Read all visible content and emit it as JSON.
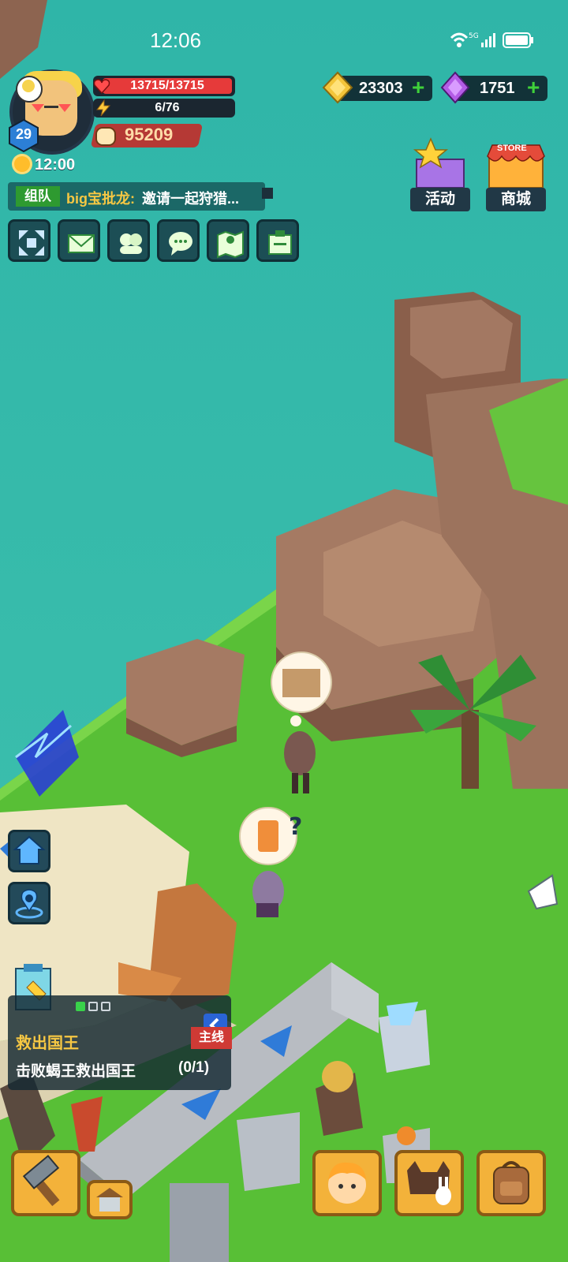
{
  "status_bar": {
    "time": "12:06",
    "icons": [
      "wifi-icon",
      "5g-icon",
      "signal-icon",
      "battery-icon"
    ]
  },
  "player": {
    "level": "29",
    "hp": "13715/13715",
    "energy": "6/76",
    "power": "95209",
    "clock": "12:00"
  },
  "currencies": {
    "gold": "23303",
    "gems": "1751"
  },
  "chat": {
    "channel": "组队",
    "sender": "big宝批龙:",
    "message": "邀请一起狩猎..."
  },
  "toolbar": [
    {
      "name": "fullscreen-icon"
    },
    {
      "name": "mail-icon"
    },
    {
      "name": "friends-icon"
    },
    {
      "name": "chat-icon"
    },
    {
      "name": "map-icon"
    },
    {
      "name": "quest-board-icon"
    }
  ],
  "events": {
    "activity_label": "活动",
    "store_label": "商城",
    "store_sign": "STORE"
  },
  "quest": {
    "title": "救出国王",
    "tag": "主线",
    "description": "击败蝎王救出国王",
    "progress": "(0/1)"
  },
  "colors": {
    "sea": "#34b8a8",
    "grass": "#5cc23a",
    "rock": "#a47a62",
    "hp": "#e63a3a",
    "accent": "#f6c743"
  }
}
